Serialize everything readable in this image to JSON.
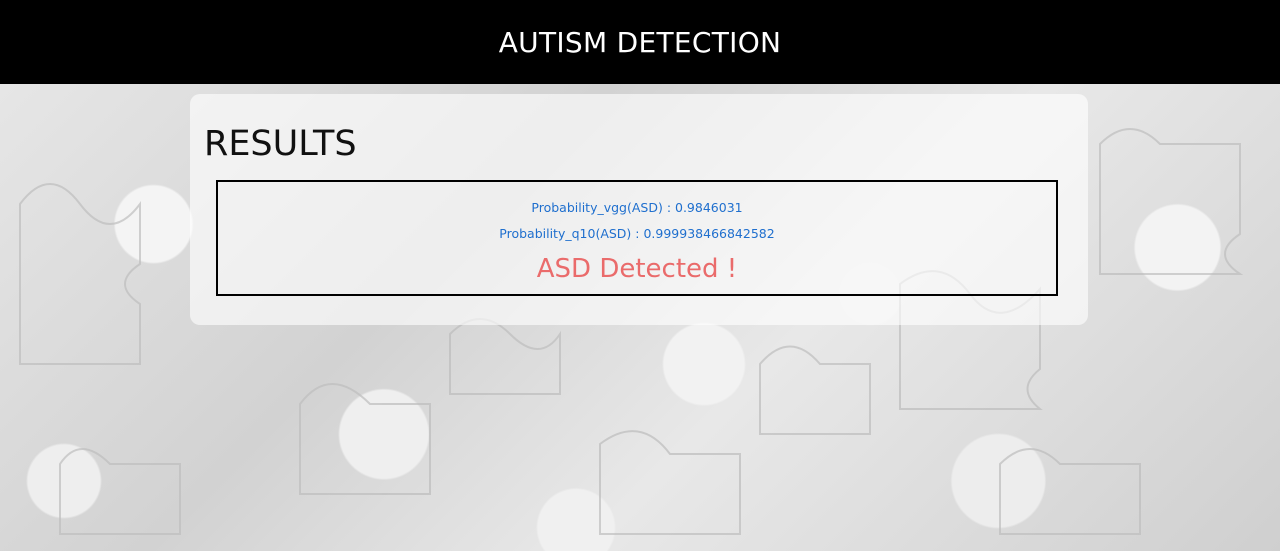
{
  "header": {
    "title": "AUTISM DETECTION"
  },
  "results": {
    "heading": "RESULTS",
    "probability_vgg": "Probability_vgg(ASD) : 0.9846031",
    "probability_q10": "Probability_q10(ASD) : 0.999938466842582",
    "verdict": "ASD Detected !"
  },
  "colors": {
    "header_bg": "#000000",
    "probability_text": "#1f6fce",
    "verdict_text": "#ea6b6b"
  }
}
